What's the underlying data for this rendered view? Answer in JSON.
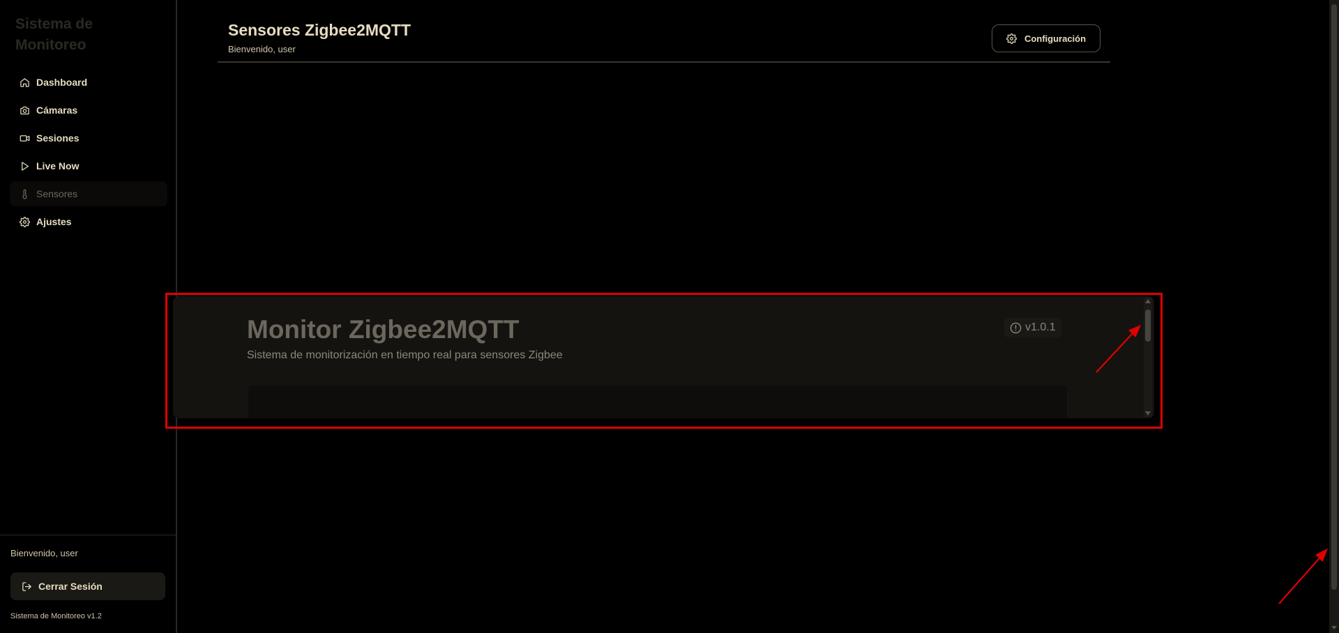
{
  "sidebar": {
    "brand": "Sistema de Monitoreo",
    "items": [
      {
        "label": "Dashboard",
        "icon": "home-icon"
      },
      {
        "label": "Cámaras",
        "icon": "camera-icon"
      },
      {
        "label": "Sesiones",
        "icon": "video-icon"
      },
      {
        "label": "Live Now",
        "icon": "play-icon"
      },
      {
        "label": "Sensores",
        "icon": "thermometer-icon",
        "active": true
      },
      {
        "label": "Ajustes",
        "icon": "gear-icon"
      }
    ],
    "welcome": "Bienvenido, user",
    "logout_label": "Cerrar Sesión",
    "version": "Sistema de Monitoreo v1.2"
  },
  "header": {
    "title": "Sensores Zigbee2MQTT",
    "subtitle": "Bienvenido, user",
    "config_label": "Configuración"
  },
  "embed": {
    "title": "Monitor Zigbee2MQTT",
    "description": "Sistema de monitorización en tiempo real para sensores Zigbee",
    "version": "v1.0.1"
  },
  "colors": {
    "background": "#000000",
    "text": "#e6dcc2",
    "annotation": "#e00000"
  }
}
